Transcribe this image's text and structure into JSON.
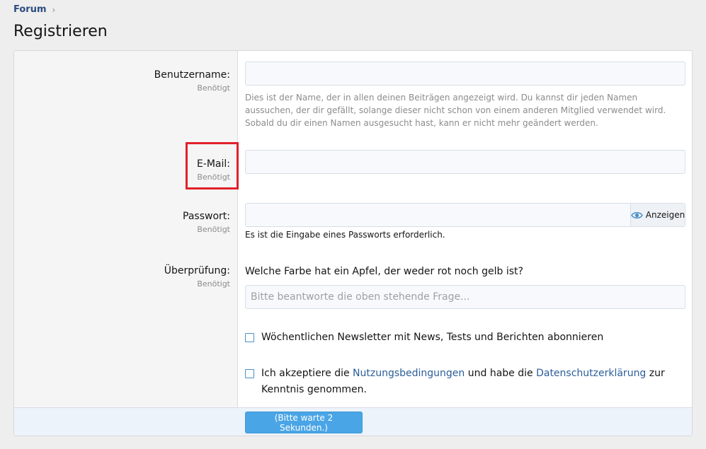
{
  "breadcrumb": {
    "item": "Forum",
    "separator": "›"
  },
  "page": {
    "title": "Registrieren"
  },
  "fields": {
    "username": {
      "label": "Benutzername:",
      "hint": "Benötigt",
      "value": "",
      "explain": "Dies ist der Name, der in allen deinen Beiträgen angezeigt wird. Du kannst dir jeden Namen aussuchen, der dir gefällt, solange dieser nicht schon von einem anderen Mitglied verwendet wird. Sobald du dir einen Namen ausgesucht hast, kann er nicht mehr geändert werden."
    },
    "email": {
      "label": "E-Mail:",
      "hint": "Benötigt",
      "value": ""
    },
    "password": {
      "label": "Passwort:",
      "hint": "Benötigt",
      "value": "",
      "toggle_label": "Anzeigen",
      "required_note": "Es ist die Eingabe eines Passworts erforderlich."
    },
    "verification": {
      "label": "Überprüfung:",
      "hint": "Benötigt",
      "question": "Welche Farbe hat ein Apfel, der weder rot noch gelb ist?",
      "placeholder": "Bitte beantworte die oben stehende Frage..."
    }
  },
  "checkboxes": {
    "newsletter": {
      "label": "Wöchentlichen Newsletter mit News, Tests und Berichten abonnieren"
    },
    "terms": {
      "text_1": "Ich akzeptiere die ",
      "link_terms": "Nutzungsbedingungen",
      "text_2": " und habe die ",
      "link_privacy": "Datenschutzerklärung",
      "text_3": " zur Kenntnis genommen."
    }
  },
  "submit": {
    "label": "(Bitte warte 2 Sekunden.)"
  },
  "colors": {
    "accent": "#4aa5e6",
    "link": "#2b5d9a",
    "highlight": "#e0212b",
    "footer_bg": "#edf3fa"
  },
  "icons": {
    "password_toggle": "eye-icon",
    "breadcrumb_separator": "chevron-right-icon"
  }
}
